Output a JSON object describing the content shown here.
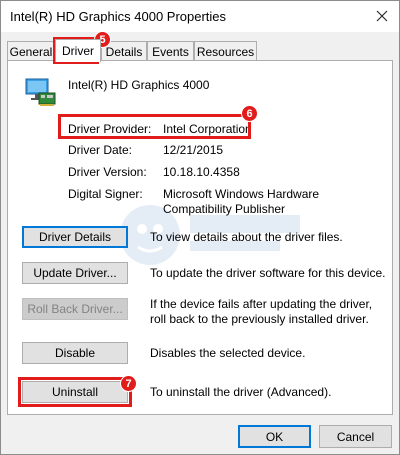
{
  "window": {
    "title": "Intel(R) HD Graphics 4000 Properties",
    "close_icon": "close-icon"
  },
  "tabs": [
    {
      "label": "General",
      "active": false
    },
    {
      "label": "Driver",
      "active": true
    },
    {
      "label": "Details",
      "active": false
    },
    {
      "label": "Events",
      "active": false
    },
    {
      "label": "Resources",
      "active": false
    }
  ],
  "device": {
    "icon": "display-adapter-icon",
    "name": "Intel(R) HD Graphics 4000"
  },
  "fields": {
    "provider": {
      "label": "Driver Provider:",
      "value": "Intel Corporation"
    },
    "date": {
      "label": "Driver Date:",
      "value": "12/21/2015"
    },
    "version": {
      "label": "Driver Version:",
      "value": "10.18.10.4358"
    },
    "signer": {
      "label": "Digital Signer:",
      "value": "Microsoft Windows Hardware Compatibility Publisher"
    }
  },
  "actions": {
    "details": {
      "label": "Driver Details",
      "description": "To view details about the driver files."
    },
    "update": {
      "label": "Update Driver...",
      "description": "To update the driver software for this device."
    },
    "rollback": {
      "label": "Roll Back Driver...",
      "description": "If the device fails after updating the driver, roll back to the previously installed driver."
    },
    "disable": {
      "label": "Disable",
      "description": "Disables the selected device."
    },
    "uninstall": {
      "label": "Uninstall",
      "description": "To uninstall the driver (Advanced)."
    }
  },
  "annotations": {
    "step5": "5",
    "step6": "6",
    "step7": "7",
    "highlight_color": "#e21b1b"
  },
  "footer": {
    "ok_label": "OK",
    "cancel_label": "Cancel"
  }
}
